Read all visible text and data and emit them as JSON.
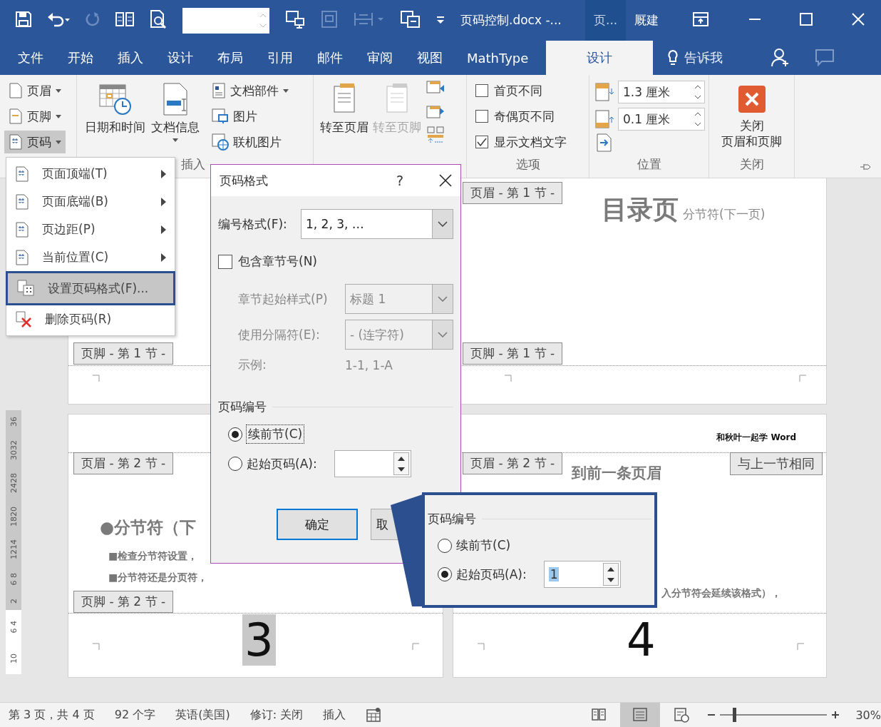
{
  "title_bar": {
    "title": "页码控制.docx -...",
    "context_tab": "页...",
    "user": "厩建"
  },
  "tabs": [
    {
      "label": "文件",
      "selected": false
    },
    {
      "label": "开始",
      "selected": false
    },
    {
      "label": "插入",
      "selected": false
    },
    {
      "label": "设计",
      "selected": false
    },
    {
      "label": "布局",
      "selected": false
    },
    {
      "label": "引用",
      "selected": false
    },
    {
      "label": "邮件",
      "selected": false
    },
    {
      "label": "审阅",
      "selected": false
    },
    {
      "label": "视图",
      "selected": false
    },
    {
      "label": "MathType",
      "selected": false
    },
    {
      "label": "设计",
      "selected": true
    }
  ],
  "tell_me": "告诉我",
  "ribbon": {
    "header_footer": [
      {
        "label": "页眉",
        "pressed": false
      },
      {
        "label": "页脚",
        "pressed": false
      },
      {
        "label": "页码",
        "pressed": true
      }
    ],
    "insert_large": [
      "日期和时间",
      "文档信息"
    ],
    "insert_small": [
      "文档部件",
      "图片",
      "联机图片"
    ],
    "insert_label": "插入",
    "navigation": [
      {
        "label": "转至页眉",
        "disabled": false
      },
      {
        "label": "转至页脚",
        "disabled": true
      }
    ],
    "options": [
      {
        "label": "首页不同",
        "checked": false
      },
      {
        "label": "奇偶页不同",
        "checked": false
      },
      {
        "label": "显示文档文字",
        "checked": true
      }
    ],
    "options_label": "选项",
    "position": [
      "1.3 厘米",
      "0.1 厘米"
    ],
    "position_label": "位置",
    "close_button": [
      "关闭",
      "页眉和页脚"
    ],
    "close_label": "关闭"
  },
  "menu": [
    {
      "label": "页面顶端(T)",
      "submenu": true,
      "selected": false
    },
    {
      "label": "页面底端(B)",
      "submenu": true,
      "selected": false
    },
    {
      "label": "页边距(P)",
      "submenu": true,
      "selected": false
    },
    {
      "label": "当前位置(C)",
      "submenu": true,
      "selected": false
    },
    {
      "label": "设置页码格式(F)...",
      "submenu": false,
      "selected": true
    },
    {
      "label": "删除页码(R)",
      "submenu": false,
      "selected": false
    }
  ],
  "ruler": [
    {
      "shaded": true,
      "labels": [
        "36",
        "3032",
        "2428",
        "1820",
        "1214",
        "6 8",
        "2"
      ]
    },
    {
      "shaded": false,
      "labels": [
        "6 4",
        "10"
      ]
    }
  ],
  "pages": [
    {
      "footer_tag": "页脚 - 第 1 节 -"
    },
    {
      "header_tag": "页眉 - 第 1 节 -",
      "heading": "目录页",
      "break_mark": "分节符(下一页)",
      "footer_tag": "页脚 - 第 1 节 -"
    },
    {
      "header_tag": "页眉 - 第 2 节 -",
      "bullet_heading": "●分节符（下",
      "notes": [
        "■检查分节符设置，",
        "■分节符还是分页符，"
      ],
      "footer_tag": "页脚 - 第 2 节 -",
      "page_number": "3",
      "highlighted": true
    },
    {
      "header_text": "和秋叶一起学 Word",
      "header_tag": "页眉 - 第 2 节 -",
      "same_as_previous": "与上一节相同",
      "body_line": "到前一条页眉",
      "body_note": "入分节符会延续该格式），",
      "page_number": "4",
      "highlighted": false
    }
  ],
  "dialog": {
    "title": "页码格式",
    "help": "?",
    "format_label": "编号格式(F):",
    "format_value": "1, 2, 3, …",
    "include_chapter": {
      "label": "包含章节号(N)",
      "checked": false
    },
    "rows": [
      {
        "label": "章节起始样式(P)",
        "value": "标题 1",
        "disabled": true
      },
      {
        "label": "使用分隔符(E):",
        "value": "-  (连字符)",
        "disabled": true
      }
    ],
    "example": {
      "label": "示例:",
      "value": "1-1, 1-A",
      "disabled": true
    },
    "numbering_title": "页码编号",
    "options": [
      {
        "kind": "radio",
        "label": "续前节(C)",
        "selected": true
      },
      {
        "kind": "radio-number",
        "label": "起始页码(A):",
        "selected": false
      }
    ],
    "ok": "确定",
    "cancel": "取"
  },
  "callout": {
    "title": "页码编号",
    "options": [
      {
        "kind": "radio",
        "label": "续前节(C)",
        "selected": false
      },
      {
        "kind": "radio-number",
        "label": "起始页码(A):",
        "selected": true,
        "value": "1"
      }
    ]
  },
  "status_bar": {
    "page": "第 3 页，共 4 页",
    "words": "92 个字",
    "language": "英语(美国)",
    "track": "修订: 关闭",
    "mode": "插入",
    "views": [
      {
        "selected": false
      },
      {
        "selected": true
      },
      {
        "selected": false
      }
    ],
    "zoom": {
      "level": 0.13,
      "label": "30%"
    }
  }
}
